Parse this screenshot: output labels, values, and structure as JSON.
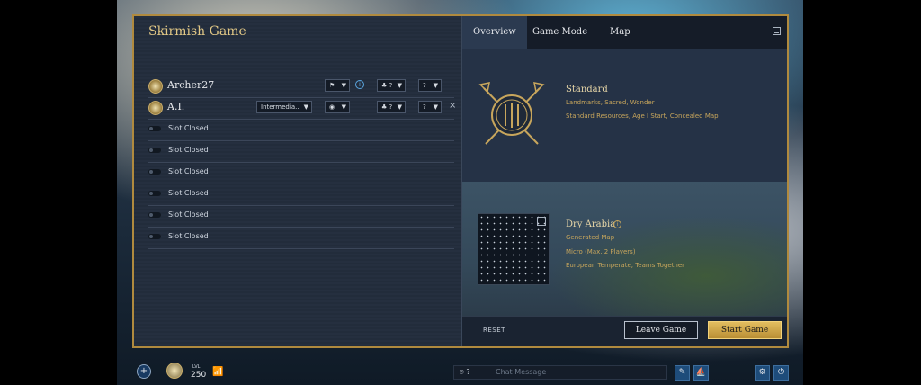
{
  "left_panel": {
    "title": "Skirmish Game",
    "players": [
      {
        "name": "Archer27",
        "difficulty": "",
        "team": "?",
        "civ": "?"
      },
      {
        "name": "A.I.",
        "difficulty": "Intermedia...",
        "team": "?",
        "civ": "?"
      }
    ],
    "slots": [
      "Slot Closed",
      "Slot Closed",
      "Slot Closed",
      "Slot Closed",
      "Slot Closed",
      "Slot Closed"
    ],
    "close_symbol": "×",
    "info_symbol": "i"
  },
  "right_panel": {
    "tabs": [
      "Overview",
      "Game Mode",
      "Map"
    ],
    "active_tab": "Overview",
    "mode": {
      "title": "Standard",
      "line1": "Landmarks, Sacred, Wonder",
      "line2": "Standard Resources, Age I Start, Concealed Map"
    },
    "map": {
      "title": "Dry Arabia",
      "type": "Generated Map",
      "size": "Micro (Max. 2 Players)",
      "biome": "European Temperate, Teams Together"
    },
    "footer": {
      "reset": "RESET",
      "leave": "Leave Game",
      "start": "Start Game"
    }
  },
  "bottom_bar": {
    "plus": "+",
    "level_label": "LVL",
    "level": "250",
    "chat_count": "?",
    "chat_placeholder": "Chat Message"
  },
  "colors": {
    "accent_gold": "#b08a3e",
    "panel_bg": "#1f2938",
    "start_button": "#e2bd5f"
  }
}
